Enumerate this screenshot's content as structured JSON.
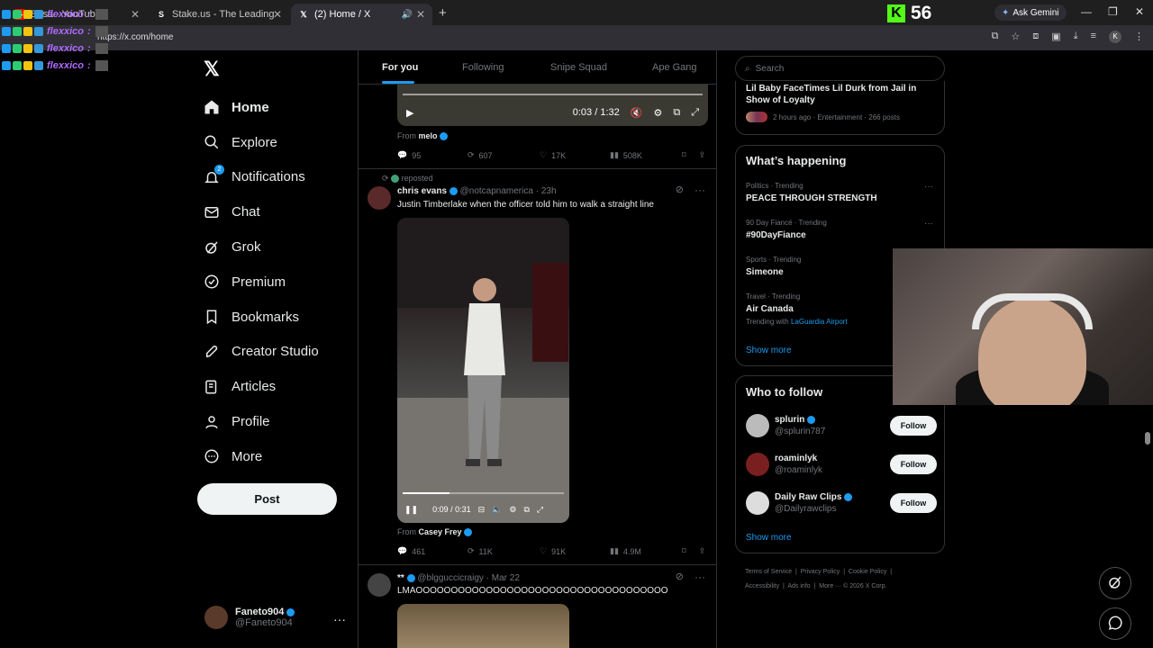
{
  "browser": {
    "tabs": [
      {
        "title": "Sosa - YouTube",
        "icon": "youtube-icon"
      },
      {
        "title": "Stake.us - The Leading Social C...",
        "icon": "stake-icon"
      },
      {
        "title": "(2) Home / X",
        "icon": "x-icon",
        "active": true
      }
    ],
    "url": "https://x.com/home",
    "kick_count": "56",
    "gemini_label": "Ask Gemini"
  },
  "chat_overlay": {
    "username": "flexxico",
    "lines": 4
  },
  "nav": {
    "items": [
      {
        "label": "Home",
        "icon": "home-icon",
        "active": true
      },
      {
        "label": "Explore",
        "icon": "search-icon"
      },
      {
        "label": "Notifications",
        "icon": "bell-icon",
        "badge": "2"
      },
      {
        "label": "Chat",
        "icon": "mail-icon"
      },
      {
        "label": "Grok",
        "icon": "grok-icon"
      },
      {
        "label": "Premium",
        "icon": "premium-icon"
      },
      {
        "label": "Bookmarks",
        "icon": "bookmark-icon"
      },
      {
        "label": "Creator Studio",
        "icon": "rocket-icon"
      },
      {
        "label": "Articles",
        "icon": "article-icon"
      },
      {
        "label": "Profile",
        "icon": "person-icon"
      },
      {
        "label": "More",
        "icon": "more-circle-icon"
      }
    ],
    "post_label": "Post"
  },
  "account": {
    "name": "Faneto904",
    "handle": "@Faneto904"
  },
  "feed_tabs": [
    "For you",
    "Following",
    "Snipe Squad",
    "Ape Gang"
  ],
  "posts": [
    {
      "video_time": "0:03 / 1:32",
      "from_label": "From",
      "from_name": "melo",
      "replies": "95",
      "reposts": "607",
      "likes": "17K",
      "views": "508K"
    },
    {
      "reposted_label": "reposted",
      "name": "chris evans",
      "handle": "@notcapnamerica",
      "time": "23h",
      "text": "Justin Timberlake when the officer told him to walk a straight line",
      "video_time": "0:09 / 0:31",
      "video_progress": 0.29,
      "from_label": "From",
      "from_name": "Casey Frey",
      "replies": "461",
      "reposts": "11K",
      "likes": "91K",
      "views": "4.9M"
    },
    {
      "name": "**",
      "handle": "@blgguccicraigy",
      "time": "Mar 22",
      "text": "LMAOOOOOOOOOOOOOOOOOOOOOOOOOOOOOOOOOOOO"
    }
  ],
  "right": {
    "search_placeholder": "Search",
    "top_story": {
      "title": "Lil Baby FaceTimes Lil Durk from Jail in Show of Loyalty",
      "meta": "2 hours ago · Entertainment · 266 posts"
    },
    "happening_title": "What’s happening",
    "trends": [
      {
        "category": "Politics · Trending",
        "name": "PEACE THROUGH STRENGTH"
      },
      {
        "category": "90 Day Fiancé · Trending",
        "name": "#90DayFiance"
      },
      {
        "category": "Sports · Trending",
        "name": "Simeone"
      },
      {
        "category": "Travel · Trending",
        "name": "Air Canada",
        "with_label": "Trending with",
        "with": "LaGuardia Airport"
      }
    ],
    "show_more": "Show more",
    "who_to_follow_title": "Who to follow",
    "follow": [
      {
        "name": "splurin",
        "handle": "@splurin787",
        "verified": true
      },
      {
        "name": "roaminlyk",
        "handle": "@roaminlyk",
        "verified": false
      },
      {
        "name": "Daily Raw Clips",
        "handle": "@Dailyrawclips",
        "verified": true
      }
    ],
    "follow_label": "Follow",
    "footer": [
      "Terms of Service",
      "|",
      "Privacy Policy",
      "|",
      "Cookie Policy",
      "|",
      "Accessibility",
      "|",
      "Ads info",
      "|",
      "More ···",
      "© 2026 X Corp."
    ]
  },
  "colors": {
    "accent": "#1d9bf0",
    "kick": "#53fc18",
    "bg": "#000000",
    "border": "#2f3336"
  }
}
